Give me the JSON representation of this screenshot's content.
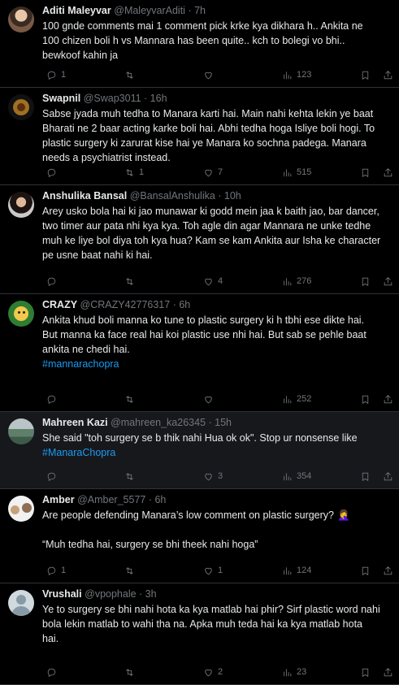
{
  "tweets": [
    {
      "name": "Aditi Maleyvar",
      "handle": "@MaleyvarAditi",
      "time": "7h",
      "lines": [
        "100 gnde comments mai 1 comment pick krke kya dikhara h.. Ankita ne",
        "100 chizen boli h vs Mannara has been quite.. kch to bolegi vo bhi..",
        "bewkoof kahin ja"
      ],
      "hashtag": "",
      "emoji": "",
      "replies": "1",
      "retweets": "",
      "likes": "",
      "views": "123"
    },
    {
      "name": "Swapnil",
      "handle": "@Swap3011",
      "time": "16h",
      "lines": [
        "Sabse jyada muh tedha to Manara karti hai. Main nahi kehta lekin ye baat",
        "Bharati ne 2 baar acting karke boli hai. Abhi tedha hoga Isliye boli hogi. To",
        "plastic surgery ki zarurat kise hai ye Manara ko sochna padega. Manara",
        "needs a psychiatrist instead."
      ],
      "hashtag": "",
      "emoji": "",
      "replies": "",
      "retweets": "1",
      "likes": "7",
      "views": "515"
    },
    {
      "name": "Anshulika Bansal",
      "handle": "@BansalAnshulika",
      "time": "10h",
      "lines": [
        "Arey usko bola hai ki jao munawar ki godd mein jaa k baith jao, bar dancer,",
        "two timer aur pata nhi kya kya. Toh agle din agar Mannara ne unke tedhe",
        "muh ke liye bol diya toh kya hua? Kam se kam Ankita aur Isha ke character",
        "pe usne baat nahi ki hai."
      ],
      "hashtag": "",
      "emoji": "",
      "replies": "",
      "retweets": "",
      "likes": "4",
      "views": "276"
    },
    {
      "name": "CRAZY",
      "handle": "@CRAZY42776317",
      "time": "6h",
      "lines": [
        "Ankita khud boli manna ko tune to plastic surgery ki h tbhi ese dikte hai.",
        "But manna ka face real hai koi plastic use nhi hai. But sab se pehle baat",
        "ankita ne chedi hai."
      ],
      "hashtag": "#mannarachopra",
      "emoji": "",
      "replies": "",
      "retweets": "",
      "likes": "",
      "views": "252"
    },
    {
      "name": "Mahreen Kazi",
      "handle": "@mahreen_ka26345",
      "time": "15h",
      "lines": [
        "She said \"toh surgery se b thik nahi Hua ok ok\". Stop ur nonsense like"
      ],
      "hashtag": "#ManaraChopra",
      "emoji": "",
      "replies": "",
      "retweets": "",
      "likes": "3",
      "views": "354"
    },
    {
      "name": "Amber",
      "handle": "@Amber_5577",
      "time": "6h",
      "lines": [
        "Are people defending Manara’s low comment on plastic surgery?",
        "",
        "“Muh tedha hai, surgery se bhi theek nahi hoga”"
      ],
      "hashtag": "",
      "emoji": "🤦‍♀️",
      "replies": "1",
      "retweets": "",
      "likes": "1",
      "views": "124"
    },
    {
      "name": "Vrushali",
      "handle": "@vpophale",
      "time": "3h",
      "lines": [
        "Ye to surgery se bhi nahi hota ka kya matlab hai phir? Sirf plastic word nahi",
        "bola lekin matlab to wahi tha na. Apka muh teda hai ka kya matlab hota",
        "hai."
      ],
      "hashtag": "",
      "emoji": "",
      "replies": "",
      "retweets": "",
      "likes": "2",
      "views": "23"
    }
  ],
  "icons": {
    "reply": "reply-icon",
    "retweet": "retweet-icon",
    "like": "heart-icon",
    "views": "bar-chart-icon",
    "bookmark": "bookmark-icon",
    "share": "share-icon"
  },
  "colors": {
    "background": "#000000",
    "highlight_background": "#16181c",
    "text": "#e7e9ea",
    "muted": "#71767b",
    "link": "#1d9bf0",
    "divider": "#2f3336"
  }
}
